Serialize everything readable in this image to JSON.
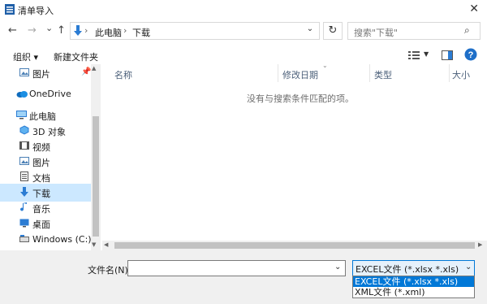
{
  "window": {
    "title": "清单导入"
  },
  "nav": {
    "back": "←",
    "forward": "→",
    "recent": "⌄",
    "up": "↑",
    "breadcrumb": [
      "此电脑",
      "下载"
    ],
    "search_placeholder": "搜索\"下载\""
  },
  "toolbar": {
    "organize": "组织 ▾",
    "new_folder": "新建文件夹"
  },
  "sidebar": {
    "items": [
      {
        "label": "图片",
        "icon": "picture-icon",
        "pinned": true
      },
      {
        "label": "OneDrive",
        "icon": "onedrive-cloud-icon"
      },
      {
        "label": "此电脑",
        "icon": "this-pc-icon"
      },
      {
        "label": "3D 对象",
        "icon": "3d-objects-icon"
      },
      {
        "label": "视频",
        "icon": "video-icon"
      },
      {
        "label": "图片",
        "icon": "picture-icon"
      },
      {
        "label": "文档",
        "icon": "document-icon"
      },
      {
        "label": "下载",
        "icon": "download-icon",
        "selected": true
      },
      {
        "label": "音乐",
        "icon": "music-icon"
      },
      {
        "label": "桌面",
        "icon": "desktop-icon"
      },
      {
        "label": "Windows (C:)",
        "icon": "drive-icon"
      }
    ]
  },
  "file_list": {
    "columns": [
      "名称",
      "修改日期",
      "类型",
      "大小"
    ],
    "empty_message": "没有与搜索条件匹配的项。"
  },
  "bottom": {
    "filename_label": "文件名(N):",
    "filename_value": "",
    "filetype_selected": "EXCEL文件 (*.xlsx *.xls)",
    "filetype_options": [
      "EXCEL文件 (*.xlsx *.xls)",
      "XML文件 (*.xml)"
    ]
  },
  "colors": {
    "accent": "#0078d7",
    "selection": "#cce8ff",
    "help": "#1e6fc8"
  }
}
